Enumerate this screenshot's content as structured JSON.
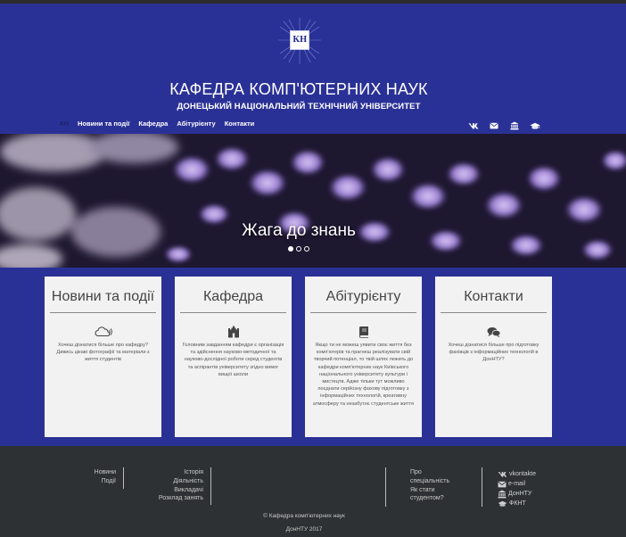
{
  "header": {
    "logo_text": "КН",
    "title": "КАФЕДРА КОМП'ЮТЕРНИХ НАУК",
    "subtitle": "ДОНЕЦЬКИЙ НАЦІОНАЛЬНИЙ ТЕХНІЧНИЙ УНІВЕРСИТЕТ",
    "nav_logo": "КН",
    "nav": [
      {
        "label": "Новини та події"
      },
      {
        "label": "Кафедра"
      },
      {
        "label": "Абітурієнту"
      },
      {
        "label": "Контакти"
      }
    ],
    "icons": [
      "vk-icon",
      "mail-icon",
      "university-icon",
      "graduation-cap-icon"
    ]
  },
  "hero": {
    "caption": "Жага до знань",
    "slides": 3,
    "active_slide": 1
  },
  "cards": [
    {
      "title": "Новини та події",
      "icon": "cloud-icon",
      "text": "Хочеш дізнатися більше про кафедру? Дивись цікаві фотографії та матеріали з життя студентів"
    },
    {
      "title": "Кафедра",
      "icon": "castle-icon",
      "text": "Головним завданням кафедри є організація та здійснення науково-методичної та науково-дослідної роботи серед студентів та аспірантів університету згідно вимог вищої школи"
    },
    {
      "title": "Абітурієнту",
      "icon": "book-icon",
      "text": "Якщо ти не можеш уявити своє життя без комп'ютерів та прагнеш реалізувати свій творчий потенціал, то твій шлях лежить до кафедри комп'ютерних наук Київського національного університету культури і мистецтв. Адже тільки тут можливо поєднати серйозну фахову підготовку з інформаційних технологій, креативну атмосферу та незабутнє студентське життя"
    },
    {
      "title": "Контакти",
      "icon": "comments-icon",
      "text": "Хочеш дізнатися більше про підготовку фахівців з інформаційних технологій в ДонНТУ?"
    }
  ],
  "footer": {
    "col1": [
      "Новини",
      "Події"
    ],
    "col2": [
      "Історія",
      "Діяльність",
      "Викладачі",
      "Розклад занять"
    ],
    "col3": [
      "Про",
      "спеціальність",
      "Як стати",
      "студентом?"
    ],
    "social": [
      {
        "icon": "vk-icon",
        "label": "vkontakte"
      },
      {
        "icon": "mail-icon",
        "label": "e-mail"
      },
      {
        "icon": "university-icon",
        "label": "ДонНТУ"
      },
      {
        "icon": "graduation-cap-icon",
        "label": "ФКНТ"
      }
    ],
    "copyright": "© Кафедра комп'ютерних наук",
    "year": "ДонНТУ 2017"
  },
  "colors": {
    "primary": "#2a3196",
    "footer": "#2d3133",
    "card": "#f2f2f2"
  }
}
